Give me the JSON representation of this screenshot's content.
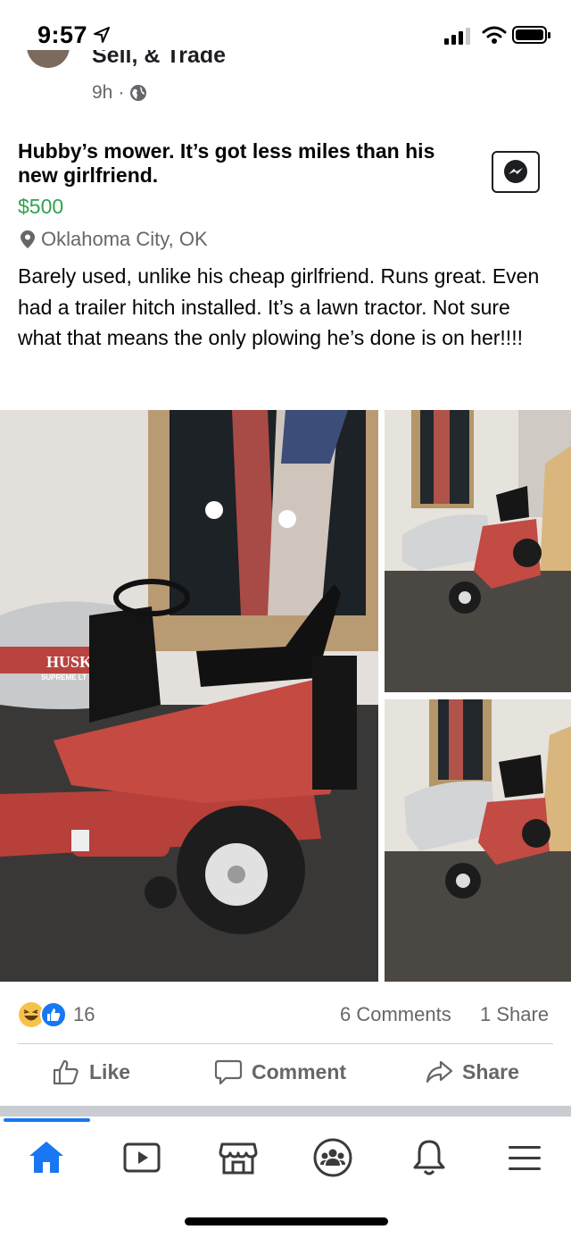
{
  "status_bar": {
    "time": "9:57"
  },
  "header": {
    "group_name": "Sell, & Trade",
    "time_ago": "9h",
    "separator": "·",
    "audience_icon": "globe-icon"
  },
  "post": {
    "title": "Hubby’s mower. It’s got less miles than his new girlfriend.",
    "price": "$500",
    "location": "Oklahoma City, OK",
    "description": "Barely used, unlike his cheap girlfriend. Runs great. Even had a trailer hitch installed. It’s a lawn tractor. Not sure what that means the only plowing he’s done is on her!!!!",
    "messenger_icon": "messenger-icon",
    "mower_brand": "HUSKEE",
    "mower_model": "SUPREME LT"
  },
  "engagement": {
    "reaction_icons": [
      "haha-icon",
      "like-icon"
    ],
    "reaction_count": "16",
    "comments": "6 Comments",
    "shares": "1 Share"
  },
  "actions": {
    "like": "Like",
    "comment": "Comment",
    "share": "Share"
  },
  "nav": {
    "items": [
      "home-icon",
      "watch-icon",
      "marketplace-icon",
      "groups-icon",
      "notifications-icon",
      "menu-icon"
    ],
    "active": "home-icon",
    "active_color": "#1877f2",
    "inactive_color": "#65676b"
  },
  "colors": {
    "price": "#31a24c",
    "secondary_text": "#65676b",
    "accent": "#1877f2"
  }
}
